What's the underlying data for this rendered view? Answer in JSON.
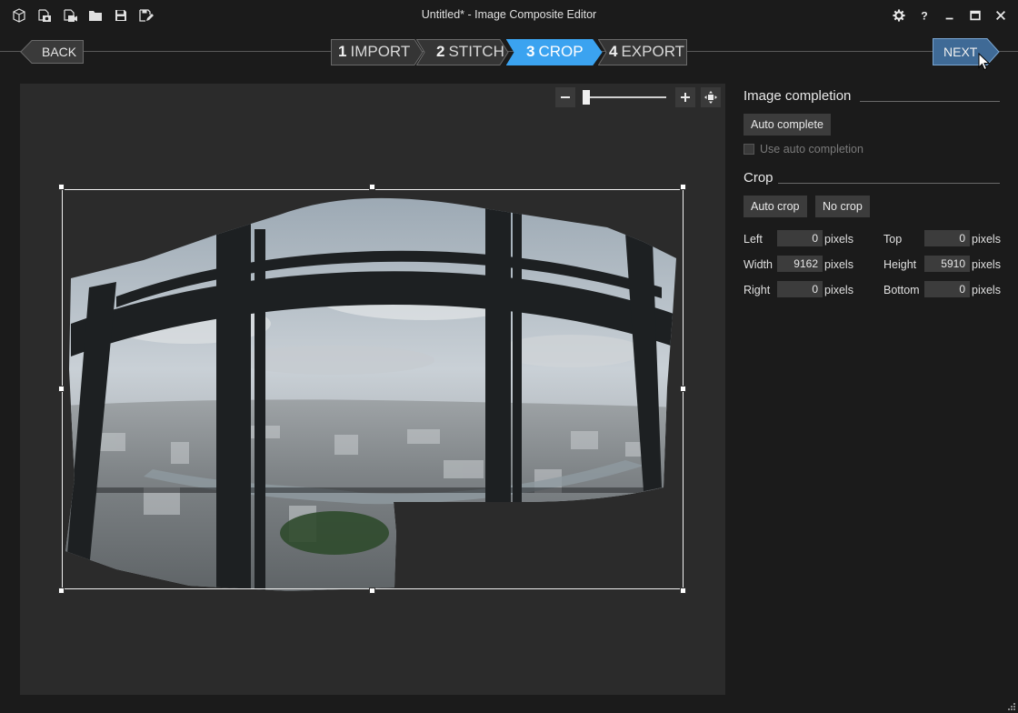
{
  "window": {
    "title": "Untitled* - Image Composite Editor"
  },
  "toolbar_icons": [
    "new-panorama-icon",
    "new-from-images-icon",
    "new-from-video-icon",
    "open-project-icon",
    "save-icon",
    "save-as-icon"
  ],
  "window_controls": [
    "settings-icon",
    "help-icon",
    "minimize-icon",
    "maximize-icon",
    "close-icon"
  ],
  "nav": {
    "back_label": "BACK",
    "next_label": "NEXT",
    "steps": [
      {
        "num": "1",
        "label": "IMPORT",
        "active": false
      },
      {
        "num": "2",
        "label": "STITCH",
        "active": false
      },
      {
        "num": "3",
        "label": "CROP",
        "active": true
      },
      {
        "num": "4",
        "label": "EXPORT",
        "active": false
      }
    ]
  },
  "zoom": {
    "minus_icon": "zoom-out-icon",
    "plus_icon": "zoom-in-icon",
    "fit_icon": "fit-to-window-icon",
    "level": 0.0
  },
  "panel": {
    "image_completion": {
      "heading": "Image completion",
      "auto_complete_label": "Auto complete",
      "use_auto_completion_label": "Use auto completion",
      "use_auto_completion_checked": false
    },
    "crop": {
      "heading": "Crop",
      "auto_crop_label": "Auto crop",
      "no_crop_label": "No crop",
      "unit": "pixels",
      "fields": {
        "left": {
          "label": "Left",
          "value": "0"
        },
        "top": {
          "label": "Top",
          "value": "0"
        },
        "width": {
          "label": "Width",
          "value": "9162"
        },
        "height": {
          "label": "Height",
          "value": "5910"
        },
        "right": {
          "label": "Right",
          "value": "0"
        },
        "bottom": {
          "label": "Bottom",
          "value": "0"
        }
      }
    }
  },
  "colors": {
    "accent": "#3ba3f0",
    "next_button": "#3f6a96",
    "background": "#1b1b1b",
    "canvas": "#2b2b2b"
  }
}
